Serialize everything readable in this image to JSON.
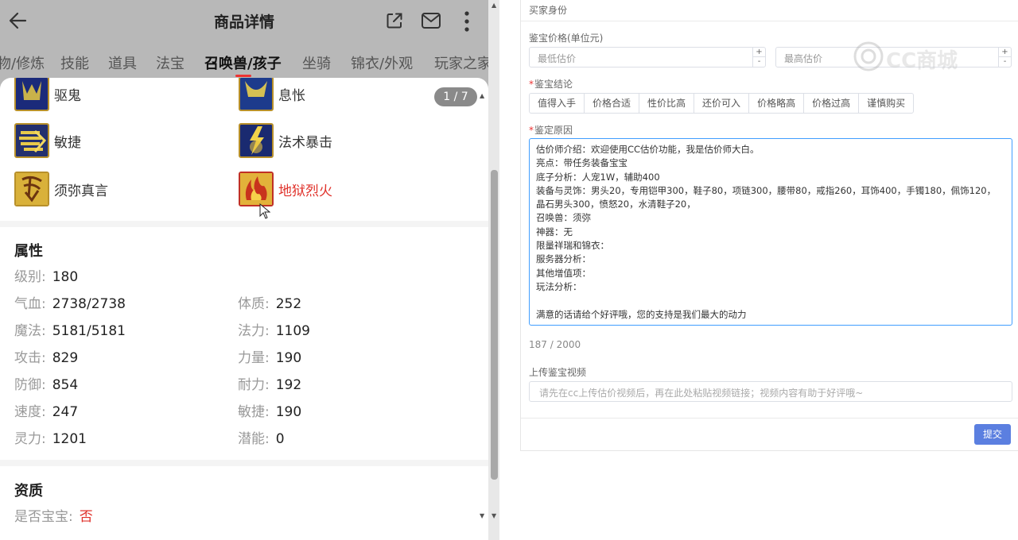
{
  "phone": {
    "header": {
      "title": "商品详情"
    },
    "tabs": [
      "物/修炼",
      "技能",
      "道具",
      "法宝",
      "召唤兽/孩子",
      "坐骑",
      "锦衣/外观",
      "玩家之家"
    ],
    "active_tab_index": 4,
    "page_indicator": "1 / 7",
    "skills": [
      {
        "label": "驱鬼",
        "icon": "ghost-skill-icon",
        "highlight": false
      },
      {
        "label": "息怅",
        "icon": "rest-skill-icon",
        "highlight": false
      },
      {
        "label": "敏捷",
        "icon": "agility-skill-icon",
        "highlight": false
      },
      {
        "label": "法术暴击",
        "icon": "spell-crit-skill-icon",
        "highlight": false
      },
      {
        "label": "须弥真言",
        "icon": "sumeru-skill-icon",
        "highlight": false
      },
      {
        "label": "地狱烈火",
        "icon": "hellfire-skill-icon",
        "highlight": true
      }
    ],
    "attributes": {
      "title": "属性",
      "level": {
        "k": "级别:",
        "v": "180"
      },
      "rows": [
        {
          "left": {
            "k": "气血:",
            "v": "2738/2738"
          },
          "right": {
            "k": "体质:",
            "v": "252"
          }
        },
        {
          "left": {
            "k": "魔法:",
            "v": "5181/5181"
          },
          "right": {
            "k": "法力:",
            "v": "1109"
          }
        },
        {
          "left": {
            "k": "攻击:",
            "v": "829"
          },
          "right": {
            "k": "力量:",
            "v": "190"
          }
        },
        {
          "left": {
            "k": "防御:",
            "v": "854"
          },
          "right": {
            "k": "耐力:",
            "v": "192"
          }
        },
        {
          "left": {
            "k": "速度:",
            "v": "247"
          },
          "right": {
            "k": "敏捷:",
            "v": "190"
          }
        },
        {
          "left": {
            "k": "灵力:",
            "v": "1201"
          },
          "right": {
            "k": "潜能:",
            "v": "0"
          }
        }
      ]
    },
    "aptitude": {
      "title": "资质",
      "is_baby": {
        "k": "是否宝宝:",
        "v": "否"
      }
    },
    "colors": {
      "accent_red": "#e0332c",
      "scrollbar": "#a8a8a8"
    }
  },
  "form": {
    "buyer_identity_label": "买家身份",
    "price_label": "鉴宝价格(单位元)",
    "min_price_placeholder": "最低估价",
    "max_price_placeholder": "最高估价",
    "conclusion_label": "鉴宝结论",
    "conclusions": [
      "值得入手",
      "价格合适",
      "性价比高",
      "还价可入",
      "价格略高",
      "价格过高",
      "谨慎购买"
    ],
    "reason_label": "鉴定原因",
    "reason_lines": [
      "估价师介绍：欢迎使用CC估价功能，我是估价师大白。",
      "亮点：带任务装备宝宝",
      "底子分析：人宠1W，辅助400",
      "装备与灵饰：男头20，专用铠甲300，鞋子80，项链300，腰带80，戒指260，耳饰400，手镯180，佩饰120，",
      "晶石男头300，愤怒20，水清鞋子20，",
      "召唤兽：须弥",
      "神器：无",
      "限量祥瑞和锦衣：",
      "服务器分析：",
      "其他增值项：",
      "玩法分析：",
      "",
      "满意的话请给个好评哦，您的支持是我们最大的动力"
    ],
    "char_counter": "187 / 2000",
    "video_label": "上传鉴宝视频",
    "video_placeholder": "请先在cc上传估价视频后，再在此处粘贴视频链接；视频内容有助于好评哦~",
    "submit_label": "提交",
    "colors": {
      "submit_bg": "#5b7fe0",
      "focus_border": "#409eff",
      "required": "#e33333"
    }
  },
  "watermark": {
    "text": "CC商城"
  }
}
